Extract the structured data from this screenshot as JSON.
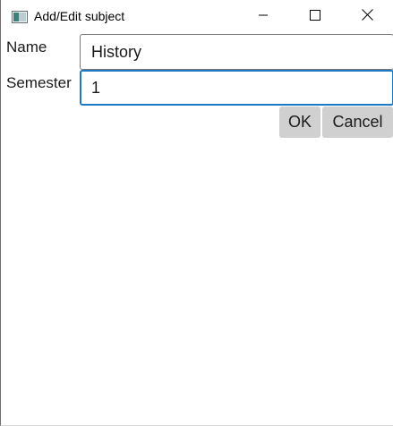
{
  "window": {
    "title": "Add/Edit subject",
    "controls": {
      "minimize": "minimize-icon",
      "maximize": "maximize-icon",
      "close": "close-icon"
    }
  },
  "form": {
    "name_label": "Name",
    "name_value": "History",
    "semester_label": "Semester",
    "semester_value": "1"
  },
  "buttons": {
    "ok_label": "OK",
    "cancel_label": "Cancel"
  },
  "colors": {
    "focus_border": "#1d79c2",
    "button_bg": "#d0d0d0"
  }
}
